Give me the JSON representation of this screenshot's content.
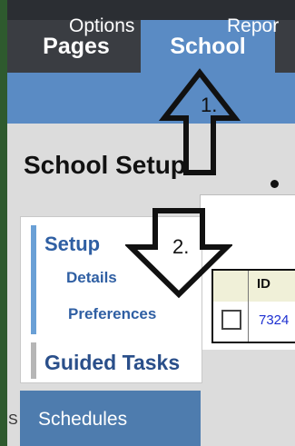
{
  "tabs": {
    "pages": "Pages",
    "school": "School"
  },
  "subnav": {
    "options": "Options",
    "reports": "Repor"
  },
  "page": {
    "title": "School Setup"
  },
  "leftnav": {
    "setup": "Setup",
    "details": "Details",
    "preferences": "Preferences",
    "guided_tasks": "Guided Tasks",
    "schedules": "Schedules",
    "cut_char": "S"
  },
  "table": {
    "header_id": "ID",
    "row_id": "7324"
  },
  "annotations": {
    "step1": "1.",
    "step2": "2."
  },
  "colors": {
    "tab_active": "#5a8bc4",
    "link": "#2f5fa3"
  },
  "icons": [
    "up-arrow-icon",
    "down-arrow-icon"
  ]
}
